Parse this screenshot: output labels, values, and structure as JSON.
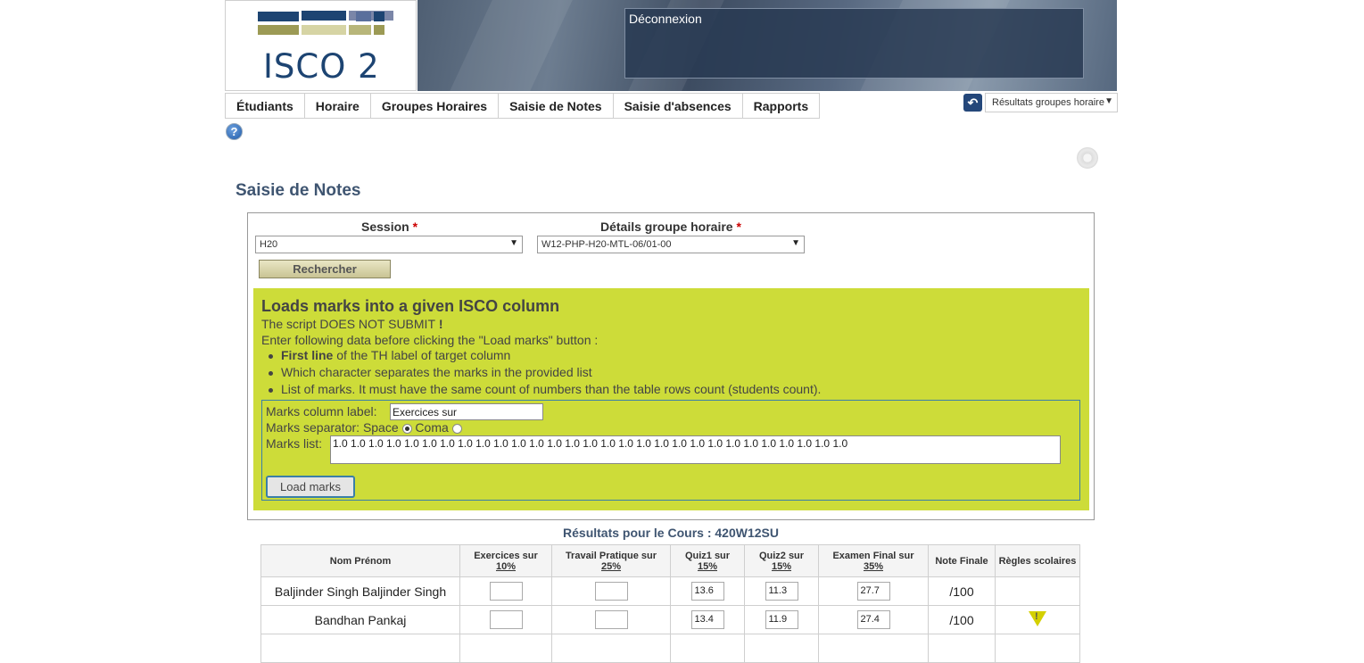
{
  "header": {
    "logo_text": "ISCO 2",
    "logout_label": "Déconnexion"
  },
  "nav": {
    "tabs": [
      "Étudiants",
      "Horaire",
      "Groupes Horaires",
      "Saisie de Notes",
      "Saisie d'absences",
      "Rapports"
    ],
    "results_select_value": "Résultats groupes horaire"
  },
  "page": {
    "title": "Saisie de Notes"
  },
  "search": {
    "session_label": "Session",
    "session_value": "H20",
    "group_label": "Détails groupe horaire",
    "group_value": "W12-PHP-H20-MTL-06/01-00",
    "required_mark": "*",
    "search_button": "Rechercher"
  },
  "script": {
    "title": "Loads marks into a given ISCO column",
    "line1_prefix": "The script DOES NOT SUBMIT",
    "line1_bang": " !",
    "line2": "Enter following data before clicking the \"Load marks\" button :",
    "bullet1_bold": "First line",
    "bullet1_rest": " of the TH label of target column",
    "bullet2": "Which character separates the marks in the provided list",
    "bullet3": "List of marks. It must have the same count of numbers than the table rows count (students count).",
    "col_label_label": "Marks column label:",
    "col_label_value": "Exercices sur",
    "separator_label": "Marks separator:",
    "sep_space": "Space",
    "sep_coma": "Coma",
    "sep_selected": "Space",
    "marks_list_label": "Marks list:",
    "marks_list_value": "1.0 1.0 1.0 1.0 1.0 1.0 1.0 1.0 1.0 1.0 1.0 1.0 1.0 1.0 1.0 1.0 1.0 1.0 1.0 1.0 1.0 1.0 1.0 1.0 1.0 1.0 1.0 1.0 1.0",
    "load_button": "Load marks"
  },
  "results": {
    "title": "Résultats pour le Cours : 420W12SU",
    "columns": [
      {
        "label": "Nom Prénom",
        "pct": ""
      },
      {
        "label": "Exercices sur",
        "pct": "10%"
      },
      {
        "label": "Travail Pratique sur",
        "pct": "25%"
      },
      {
        "label": "Quiz1 sur",
        "pct": "15%"
      },
      {
        "label": "Quiz2 sur",
        "pct": "15%"
      },
      {
        "label": "Examen Final sur",
        "pct": "35%"
      },
      {
        "label": "Note Finale",
        "pct": ""
      },
      {
        "label": "Règles scolaires",
        "pct": ""
      }
    ],
    "rows": [
      {
        "name": "Baljinder Singh Baljinder Singh",
        "exercices": "",
        "tp": "",
        "quiz1": "13.6",
        "quiz2": "11.3",
        "final": "27.7",
        "note": "/100",
        "warning": false
      },
      {
        "name": "Bandhan Pankaj",
        "exercices": "",
        "tp": "",
        "quiz1": "13.4",
        "quiz2": "11.9",
        "final": "27.4",
        "note": "/100",
        "warning": true
      }
    ],
    "warning_glyph": "!"
  }
}
